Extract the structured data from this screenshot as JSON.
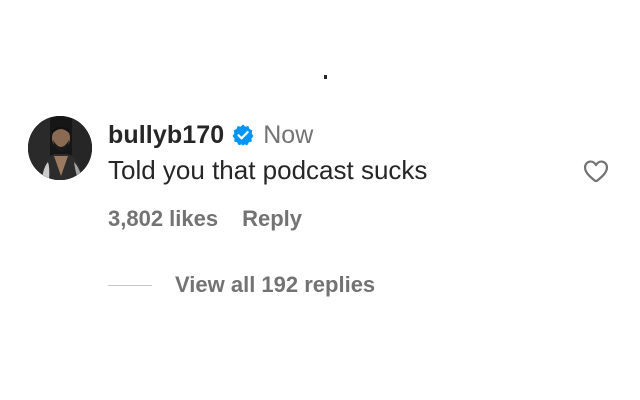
{
  "comment": {
    "username": "bullyb170",
    "timestamp": "Now",
    "text": "Told you that podcast sucks",
    "likes": "3,802 likes",
    "reply_label": "Reply",
    "view_replies_label": "View all 192 replies"
  },
  "icons": {
    "verified": "verified-badge-icon",
    "like": "heart-outline-icon",
    "avatar": "profile-avatar"
  },
  "colors": {
    "text_primary": "#262626",
    "text_secondary": "#737373",
    "verified_blue": "#0095F6",
    "divider": "#c7c7c7"
  }
}
